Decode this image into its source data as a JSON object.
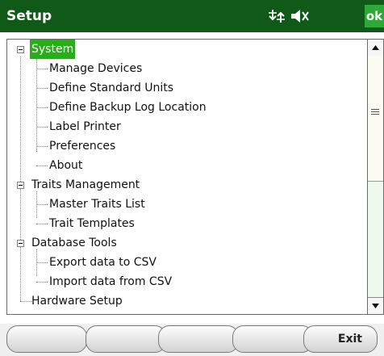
{
  "window": {
    "title": "Setup",
    "ok_label": "ok"
  },
  "status_icons": [
    "network-sync-icon",
    "speaker-muted-icon"
  ],
  "tree": {
    "system": {
      "label": "System",
      "children": [
        "Manage Devices",
        "Define Standard Units",
        "Define Backup Log Location",
        "Label Printer",
        "Preferences",
        "About"
      ]
    },
    "traits": {
      "label": "Traits Management",
      "children": [
        "Master Traits List",
        "Trait Templates"
      ]
    },
    "database": {
      "label": "Database Tools",
      "children": [
        "Export data to CSV",
        "Import data from CSV"
      ]
    },
    "hardware": {
      "label": "Hardware Setup"
    }
  },
  "softkeys": {
    "exit_label": "Exit"
  },
  "colors": {
    "titlebar": "#0f5a18",
    "selection": "#2cab1f",
    "ok_button": "#2ea836"
  }
}
